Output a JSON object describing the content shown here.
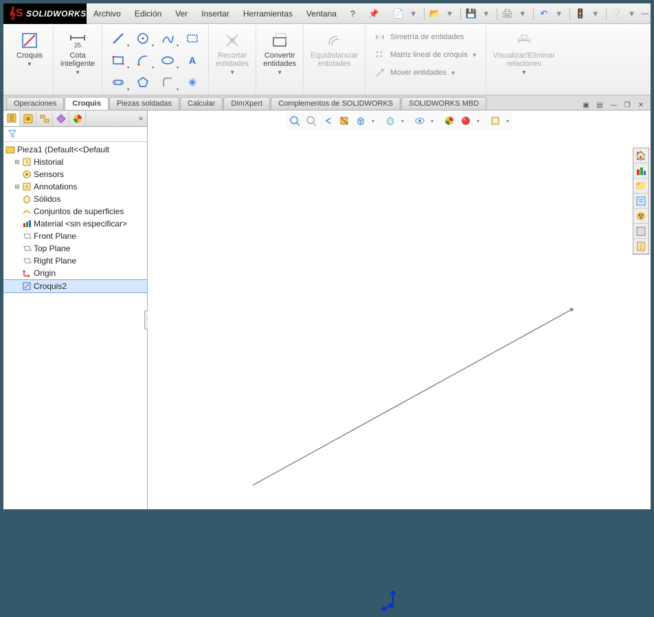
{
  "app": {
    "name": "SOLIDWORKS"
  },
  "menu": {
    "archivo": "Archivo",
    "edicion": "Edición",
    "ver": "Ver",
    "insertar": "Insertar",
    "herramientas": "Herramientas",
    "ventana": "Ventana",
    "ayuda": "?"
  },
  "ribbon": {
    "croquis": "Croquis",
    "cota": "Cota\ninteligente",
    "recortar": "Recortar\nentidades",
    "convertir": "Convertir\nentidades",
    "equidist": "Equidistanciar\nentidades",
    "simetria": "Simetría de entidades",
    "matriz": "Matriz lineal de croquis",
    "mover": "Mover entidades",
    "visualizar": "Visualizar/Eliminar\nrelaciones"
  },
  "tabs": {
    "operaciones": "Operaciones",
    "croquis": "Croquis",
    "piezas": "Piezas soldadas",
    "calcular": "Calcular",
    "dimxpert": "DimXpert",
    "complementos": "Complementos de SOLIDWORKS",
    "mbd": "SOLIDWORKS MBD"
  },
  "tree": {
    "root": "Pieza1  (Default<<Default",
    "historial": "Historial",
    "sensors": "Sensors",
    "annotations": "Annotations",
    "solidos": "Sólidos",
    "superficies": "Conjuntos de superficies",
    "material": "Material <sin especificar>",
    "front": "Front Plane",
    "top": "Top Plane",
    "right": "Right Plane",
    "origin": "Origin",
    "croquis2": "Croquis2"
  }
}
